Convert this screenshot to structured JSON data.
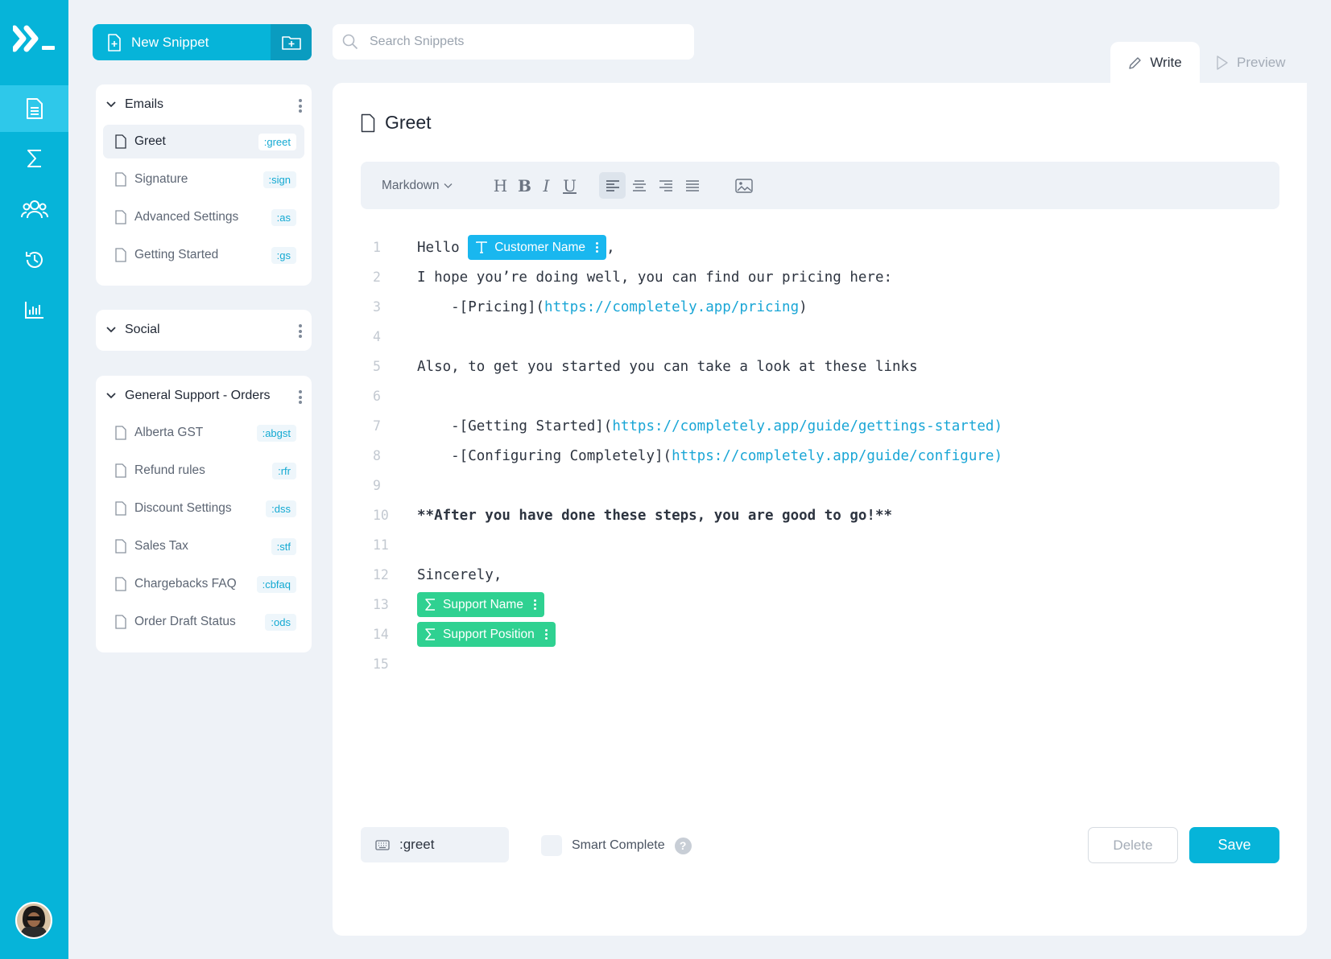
{
  "theme": {
    "accent": "#06b4d9",
    "accent_dark": "#0a9cc0",
    "variable_chip": "#19b7ef",
    "formula_chip": "#2fd191",
    "link": "#1aa6d6"
  },
  "rail": {
    "icons": [
      "document-icon",
      "sigma-icon",
      "users-icon",
      "history-icon",
      "chart-icon"
    ],
    "active": "document-icon"
  },
  "new_snippet": {
    "label": "New Snippet"
  },
  "search": {
    "placeholder": "Search Snippets"
  },
  "folders": [
    {
      "name": "Emails",
      "expanded": true,
      "items": [
        {
          "name": "Greet",
          "shortcut": ":greet",
          "selected": true
        },
        {
          "name": "Signature",
          "shortcut": ":sign"
        },
        {
          "name": "Advanced Settings",
          "shortcut": ":as"
        },
        {
          "name": "Getting Started",
          "shortcut": ":gs"
        }
      ]
    },
    {
      "name": "Social",
      "expanded": true,
      "items": []
    },
    {
      "name": "General Support - Orders",
      "expanded": true,
      "items": [
        {
          "name": "Alberta GST",
          "shortcut": ":abgst"
        },
        {
          "name": "Refund rules",
          "shortcut": ":rfr"
        },
        {
          "name": "Discount Settings",
          "shortcut": ":dss"
        },
        {
          "name": "Sales Tax",
          "shortcut": ":stf"
        },
        {
          "name": "Chargebacks FAQ",
          "shortcut": ":cbfaq"
        },
        {
          "name": "Order Draft Status",
          "shortcut": ":ods"
        }
      ]
    }
  ],
  "tabs": {
    "write": "Write",
    "preview": "Preview",
    "active": "write"
  },
  "editor": {
    "title": "Greet",
    "format": "Markdown",
    "toolbar": {
      "heading": "H",
      "bold": "B",
      "italic": "I",
      "underline": "U"
    },
    "lines": [
      {
        "num": "1",
        "text": "Hello ",
        "chip": "Customer Name",
        "after": ","
      },
      {
        "num": "2",
        "text": "I hope you’re doing well, you can find our pricing here:"
      },
      {
        "num": "3",
        "text": "    -[Pricing](",
        "link": "https://completely.app/pricing",
        "after": ")"
      },
      {
        "num": "4",
        "text": ""
      },
      {
        "num": "5",
        "text": "Also, to get you started you can take a look at these links"
      },
      {
        "num": "6",
        "text": ""
      },
      {
        "num": "7",
        "text": "    -[Getting Started](",
        "link": "https://completely.app/guide/gettings-started)",
        "after": ""
      },
      {
        "num": "8",
        "text": "    -[Configuring Completely](",
        "link": "https://completely.app/guide/configure)",
        "after": ""
      },
      {
        "num": "9",
        "text": ""
      },
      {
        "num": "10",
        "text": "**After you have done these steps, you are good to go!**"
      },
      {
        "num": "11",
        "text": ""
      },
      {
        "num": "12",
        "text": "Sincerely,"
      },
      {
        "num": "13",
        "text": "",
        "chip": "Support Name"
      },
      {
        "num": "14",
        "text": "",
        "chip": "Support Position"
      },
      {
        "num": "15",
        "text": ""
      }
    ]
  },
  "footer": {
    "shortcut": ":greet",
    "smart_complete": "Smart Complete",
    "help": "?",
    "delete": "Delete",
    "save": "Save"
  }
}
